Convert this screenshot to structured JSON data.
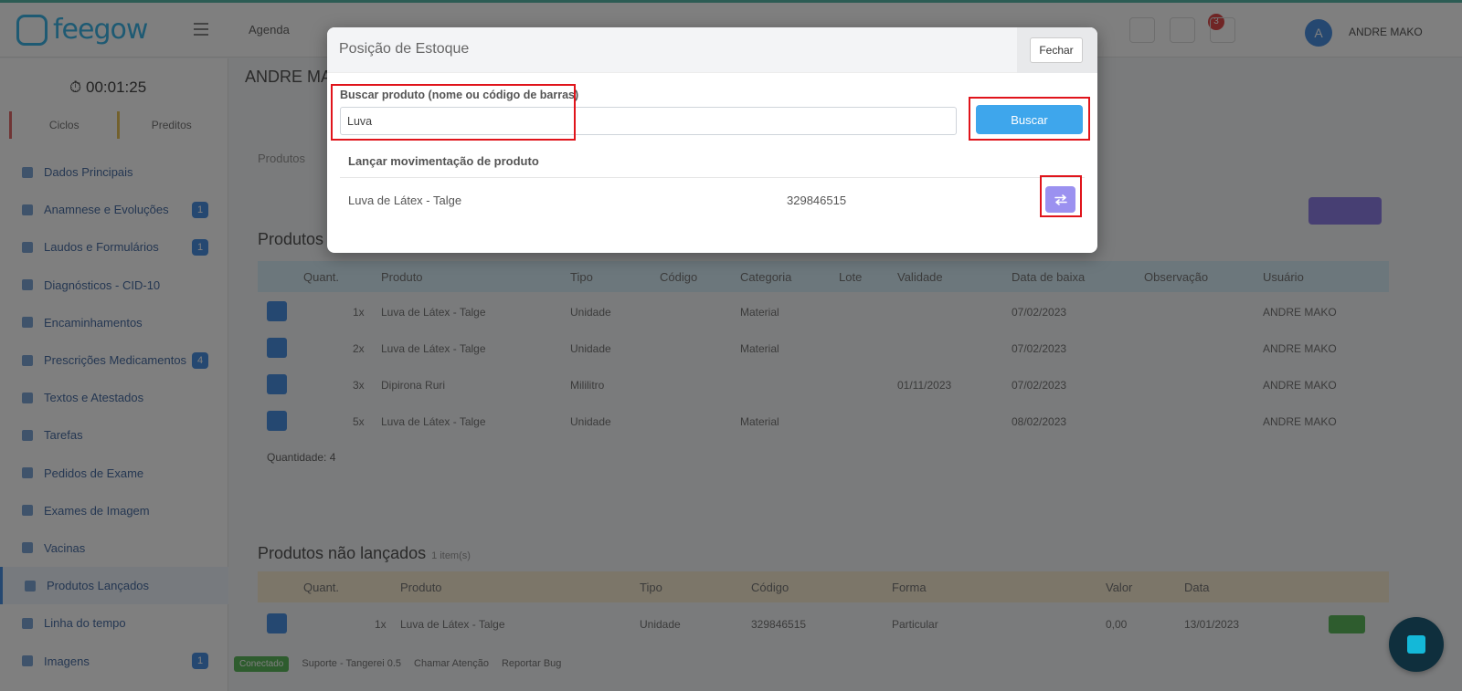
{
  "app": {
    "brand": "feegow",
    "nav_agenda": "Agenda",
    "notifications_count": "3",
    "user_initial": "A",
    "user_name": "ANDRE MAKO"
  },
  "sidebar": {
    "timer": "⏱ 00:01:25",
    "tabs": [
      "Ciclos",
      "Preditos"
    ],
    "items": [
      {
        "label": "Dados Principais",
        "count": ""
      },
      {
        "label": "Anamnese e Evoluções",
        "count": "1"
      },
      {
        "label": "Laudos e Formulários",
        "count": "1"
      },
      {
        "label": "Diagnósticos - CID-10",
        "count": ""
      },
      {
        "label": "Encaminhamentos",
        "count": ""
      },
      {
        "label": "Prescrições Medicamentos",
        "count": "4"
      },
      {
        "label": "Textos e Atestados",
        "count": ""
      },
      {
        "label": "Tarefas",
        "count": ""
      },
      {
        "label": "Pedidos de Exame",
        "count": ""
      },
      {
        "label": "Exames de Imagem",
        "count": ""
      },
      {
        "label": "Vacinas",
        "count": ""
      },
      {
        "label": "Produtos Lançados",
        "count": ""
      },
      {
        "label": "Linha do tempo",
        "count": ""
      },
      {
        "label": "Imagens",
        "count": "1"
      }
    ]
  },
  "main": {
    "title": "ANDRE MAKO",
    "filter_label": "Produtos",
    "launched_title": "Produtos",
    "launched_headers": [
      "Quant.",
      "Produto",
      "Tipo",
      "Código",
      "Categoria",
      "Lote",
      "Validade",
      "Data de baixa",
      "Observação",
      "Usuário"
    ],
    "launched_rows": [
      {
        "qty": "1x",
        "product": "Luva de Látex - Talge",
        "type": "Unidade",
        "category": "Material",
        "validity": "",
        "date": "07/02/2023",
        "user": "ANDRE MAKO"
      },
      {
        "qty": "2x",
        "product": "Luva de Látex - Talge",
        "type": "Unidade",
        "category": "Material",
        "validity": "",
        "date": "07/02/2023",
        "user": "ANDRE MAKO"
      },
      {
        "qty": "3x",
        "product": "Dipirona Ruri",
        "type": "Mililitro",
        "category": "",
        "validity": "01/11/2023",
        "date": "07/02/2023",
        "user": "ANDRE MAKO"
      },
      {
        "qty": "5x",
        "product": "Luva de Látex - Talge",
        "type": "Unidade",
        "category": "Material",
        "validity": "",
        "date": "08/02/2023",
        "user": "ANDRE MAKO"
      }
    ],
    "quantity_label": "Quantidade: 4",
    "not_launched_title": "Produtos não lançados",
    "not_launched_sub": "1 item(s)",
    "not_launched_headers": [
      "Quant.",
      "Produto",
      "Tipo",
      "Código",
      "Forma",
      "Valor",
      "Data"
    ],
    "not_launched_row": {
      "qty": "1x",
      "product": "Luva de Látex - Talge",
      "type": "Unidade",
      "code": "329846515",
      "form": "Particular",
      "value": "0,00",
      "date": "13/01/2023"
    }
  },
  "statusbar": {
    "pill": "Conectado",
    "items": [
      "Suporte - Tangerei 0.5",
      "Chamar Atenção",
      "Reportar Bug"
    ]
  },
  "modal": {
    "title": "Posição de Estoque",
    "close_label": "Fechar",
    "search_label": "Buscar produto (nome ou código de barras)",
    "search_value": "Luva",
    "search_button": "Buscar",
    "results_header": "Lançar movimentação de produto",
    "result": {
      "name": "Luva de Látex - Talge",
      "code": "329846515"
    }
  },
  "colors": {
    "accent": "#3ea6ec",
    "move_button": "#9b91f0",
    "highlight": "#e0141b"
  }
}
